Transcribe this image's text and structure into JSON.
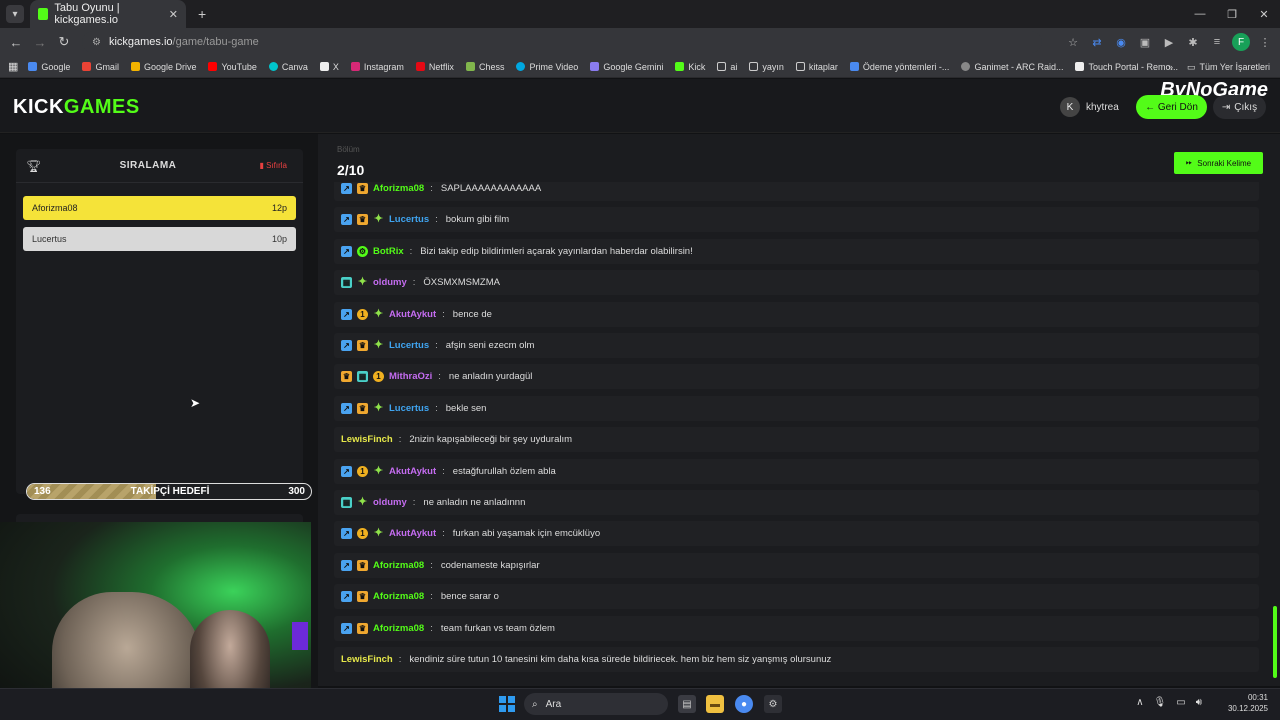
{
  "browser": {
    "tab_title": "Tabu Oyunu | kickgames.io",
    "url_host": "kickgames.io",
    "url_path": "/game/tabu-game",
    "bookmarks": [
      "Google",
      "Gmail",
      "Google Drive",
      "YouTube",
      "Canva",
      "X",
      "Instagram",
      "Netflix",
      "Chess",
      "Prime Video",
      "Google Gemini",
      "Kick",
      "ai",
      "yayın",
      "kitaplar",
      "Ödeme yöntemleri -...",
      "Ganimet - ARC Raid...",
      "Touch Portal - Remo..."
    ],
    "all_bookmarks": "Tüm Yer İşaretleri",
    "profile_initial": "F"
  },
  "site": {
    "logo_white": "KICK",
    "logo_green": "GAMES",
    "overlay_brand": "ByNoGame",
    "username": "khytrea",
    "back_label": "← Geri Dön",
    "exit_label": "Çıkış"
  },
  "ranking": {
    "title": "SIRALAMA",
    "reset_label": "Sıfırla",
    "rows": [
      {
        "name": "Aforizma08",
        "points": "12p"
      },
      {
        "name": "Lucertus",
        "points": "10p"
      }
    ]
  },
  "follower_goal": {
    "label": "TAKİPÇİ HEDEFİ",
    "current": "136",
    "target": "300",
    "progress": 0.4533
  },
  "game": {
    "round_label": "Bölüm",
    "round": "2/10",
    "next_label": "Sonraki Kelime"
  },
  "chat": [
    {
      "badges": [
        "arrow",
        "crown"
      ],
      "user": "Aforizma08",
      "color": "green",
      "text": "SAPLAAAAAAAAAAAA"
    },
    {
      "badges": [
        "arrow",
        "crown",
        "spark"
      ],
      "user": "Lucertus",
      "color": "blue",
      "text": "bokum gibi film"
    },
    {
      "badges": [
        "arrow",
        "bot"
      ],
      "user": "BotRix",
      "color": "green",
      "text": "Bizi takip edip bildirimleri açarak yayınlardan haberdar olabilirsin!"
    },
    {
      "badges": [
        "gift",
        "spark"
      ],
      "user": "oldumy",
      "color": "purple",
      "text": "ÖXSMXMSMZMA"
    },
    {
      "badges": [
        "arrow",
        "one",
        "spark"
      ],
      "user": "AkutAykut",
      "color": "purple",
      "text": "bence de"
    },
    {
      "badges": [
        "arrow",
        "crown",
        "spark"
      ],
      "user": "Lucertus",
      "color": "blue",
      "text": "afşin seni ezecm olm"
    },
    {
      "badges": [
        "crown",
        "gift",
        "one"
      ],
      "user": "MithraOzi",
      "color": "purple",
      "text": "ne anladın yurdagül"
    },
    {
      "badges": [
        "arrow",
        "crown",
        "spark"
      ],
      "user": "Lucertus",
      "color": "blue",
      "text": "bekle sen"
    },
    {
      "badges": [],
      "user": "LewisFinch",
      "color": "yellow",
      "text": "2nizin kapışabileceği bir şey uyduralım"
    },
    {
      "badges": [
        "arrow",
        "one",
        "spark"
      ],
      "user": "AkutAykut",
      "color": "purple",
      "text": "estağfurullah özlem abla"
    },
    {
      "badges": [
        "gift",
        "spark"
      ],
      "user": "oldumy",
      "color": "purple",
      "text": "ne anladın ne anladınnn"
    },
    {
      "badges": [
        "arrow",
        "one",
        "spark"
      ],
      "user": "AkutAykut",
      "color": "purple",
      "text": "furkan abi yaşamak için emcüklüyo"
    },
    {
      "badges": [
        "arrow",
        "crown"
      ],
      "user": "Aforizma08",
      "color": "green",
      "text": "codenameste kapışırlar"
    },
    {
      "badges": [
        "arrow",
        "crown"
      ],
      "user": "Aforizma08",
      "color": "green",
      "text": "bence sarar o"
    },
    {
      "badges": [
        "arrow",
        "crown"
      ],
      "user": "Aforizma08",
      "color": "green",
      "text": "team furkan vs team özlem"
    },
    {
      "badges": [],
      "user": "LewisFinch",
      "color": "yellow",
      "text": "kendiniz süre tutun 10 tanesini kim daha kısa sürede bildiriecek. hem biz hem siz yanşmış olursunuz"
    }
  ],
  "taskbar": {
    "search_placeholder": "Ara",
    "time": "00:31",
    "date": "30.12.2025"
  },
  "colors": {
    "accent": "#53fc18",
    "rank1": "#f5e339",
    "rank2": "#d8d8d8",
    "reset": "#e84040"
  }
}
